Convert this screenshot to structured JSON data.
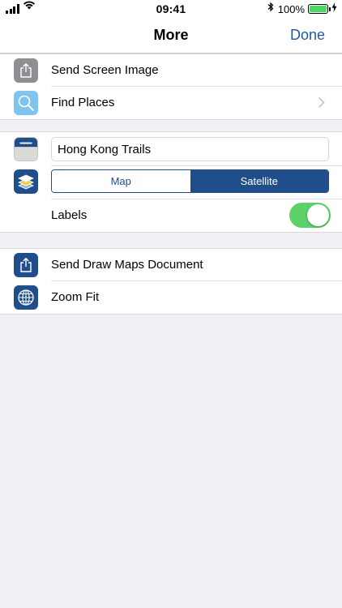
{
  "status_bar": {
    "time": "09:41",
    "battery_percent": "100%",
    "battery_level": 1.0,
    "icons": [
      "signal-icon",
      "wifi-icon",
      "bluetooth-icon",
      "battery-icon",
      "charging-bolt-icon"
    ]
  },
  "nav": {
    "title": "More",
    "done_label": "Done"
  },
  "group1": {
    "items": [
      {
        "label": "Send Screen Image",
        "icon": "share-icon",
        "icon_color": "#8e8e93"
      },
      {
        "label": "Find Places",
        "icon": "magnifier-icon",
        "icon_color": "#7fc4ee",
        "has_chevron": true
      }
    ]
  },
  "group2": {
    "map_name_value": "Hong Kong Trails",
    "map_type": {
      "options": [
        "Map",
        "Satellite"
      ],
      "selected": "Satellite"
    },
    "labels": {
      "label": "Labels",
      "enabled": true
    }
  },
  "group3": {
    "items": [
      {
        "label": "Send Draw Maps Document",
        "icon": "share-icon",
        "icon_color": "#1f4e8a"
      },
      {
        "label": "Zoom Fit",
        "icon": "globe-icon",
        "icon_color": "#1f4e8a"
      }
    ]
  },
  "colors": {
    "accent": "#1f4e8a",
    "done_text": "#1f5a99",
    "toggle_on": "#5dd16a",
    "background": "#efeff4"
  }
}
